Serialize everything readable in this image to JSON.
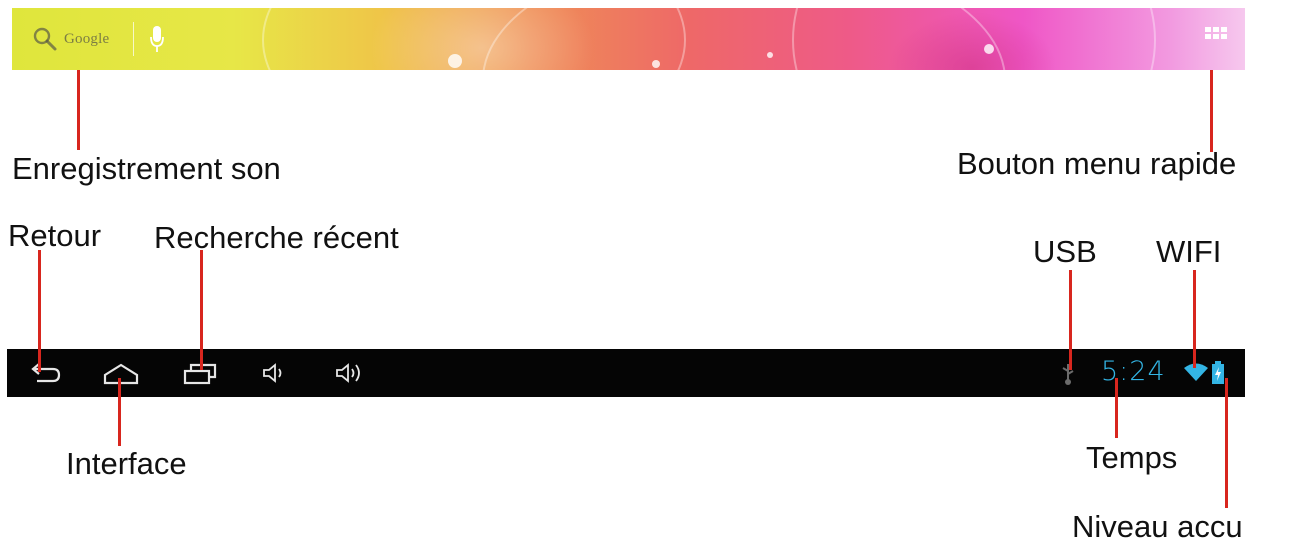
{
  "search_bar": {
    "search_label": "Google",
    "icons": {
      "search": "search-icon",
      "mic": "mic-icon",
      "apps": "apps-grid-icon"
    }
  },
  "nav_bar": {
    "buttons": [
      "back-icon",
      "home-icon",
      "recent-apps-icon",
      "volume-down-icon",
      "volume-up-icon"
    ],
    "status": {
      "time": "5:24",
      "icons": [
        "usb-icon",
        "wifi-icon",
        "battery-charging-icon"
      ]
    }
  },
  "callouts": {
    "voice_search": "Enregistrement son",
    "quick_menu": "Bouton menu rapide",
    "back": "Retour",
    "recent": "Recherche récent",
    "usb": "USB",
    "wifi": "WIFI",
    "home": "Interface",
    "time": "Temps",
    "battery": "Niveau accu"
  },
  "colors": {
    "leader_line": "#d8261e",
    "time_text": "#33b5e5",
    "nav_background": "#050505"
  }
}
